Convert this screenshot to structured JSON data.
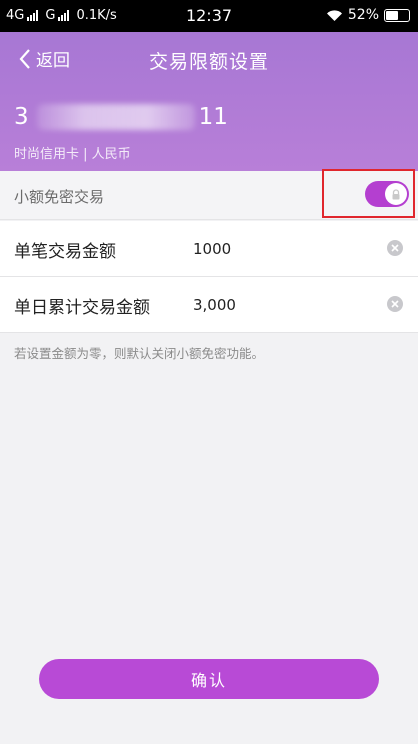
{
  "status_bar": {
    "network_1": "4G",
    "network_2": "G",
    "speed": "0.1K/s",
    "time": "12:37",
    "battery": "52%",
    "icons": [
      "signal-icon",
      "wifi-icon",
      "battery-icon"
    ]
  },
  "header": {
    "back_label": "返回",
    "title": "交易限额设置",
    "card_prefix": "3",
    "card_suffix": "11",
    "card_sub": "时尚信用卡 | 人民币",
    "color": "#b07bd6"
  },
  "small_free": {
    "label": "小额免密交易",
    "enabled": true,
    "accent": "#b43fd0"
  },
  "fields": {
    "single_label": "单笔交易金额",
    "single_value": "1000",
    "daily_label": "单日累计交易金额",
    "daily_value": "3,000"
  },
  "hint": "若设置金额为零，则默认关闭小额免密功能。",
  "confirm_label": "确认"
}
